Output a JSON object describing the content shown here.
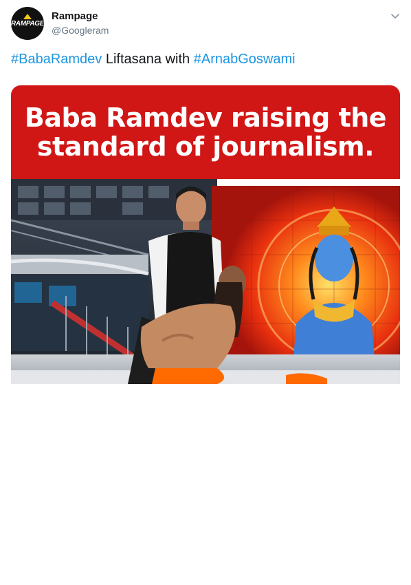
{
  "author": {
    "display_name": "Rampage",
    "handle": "@Googleram",
    "avatar_logo_text": "RAMPAGE",
    "avatar_icon": "rampage-logo"
  },
  "tweet": {
    "hashtag_1": "#BabaRamdev",
    "text_mid": " Liftasana with ",
    "hashtag_2": "#ArnabGoswami"
  },
  "media": {
    "banner_line_1": "Baba Ramdev raising the",
    "banner_line_2": "standard of journalism."
  },
  "icons": {
    "menu": "chevron-down-icon"
  },
  "colors": {
    "link": "#1b95e0",
    "banner_red": "#d11616",
    "text": "#14171a",
    "muted": "#657786"
  }
}
